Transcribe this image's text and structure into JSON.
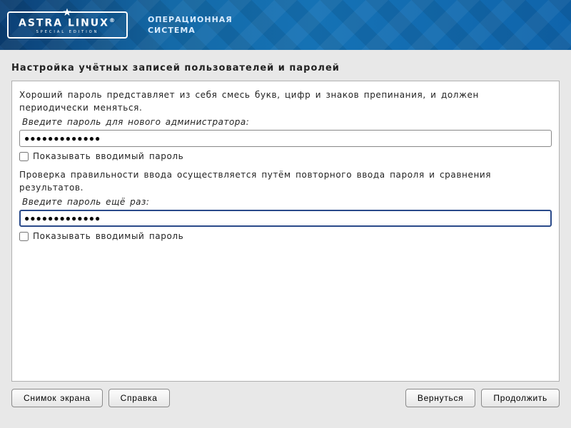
{
  "banner": {
    "logo_main": "ASTRA LINUX",
    "logo_reg": "®",
    "logo_sub": "SPECIAL EDITION",
    "tagline_line1": "ОПЕРАЦИОННАЯ",
    "tagline_line2": "СИСТЕМА"
  },
  "page": {
    "title": "Настройка учётных записей пользователей и паролей"
  },
  "form": {
    "info1": "Хороший пароль представляет из себя смесь букв, цифр и знаков препинания, и должен периодически меняться.",
    "prompt1": "Введите пароль для нового администратора:",
    "password1_display": "●●●●●●●●●●●●●",
    "show1_label": "Показывать вводимый пароль",
    "show1_checked": false,
    "info2": "Проверка правильности ввода осуществляется путём повторного ввода пароля и сравнения результатов.",
    "prompt2": "Введите пароль ещё раз:",
    "password2_display": "●●●●●●●●●●●●●",
    "show2_label": "Показывать вводимый пароль",
    "show2_checked": false
  },
  "buttons": {
    "screenshot": "Снимок экрана",
    "help": "Справка",
    "back": "Вернуться",
    "continue": "Продолжить"
  }
}
